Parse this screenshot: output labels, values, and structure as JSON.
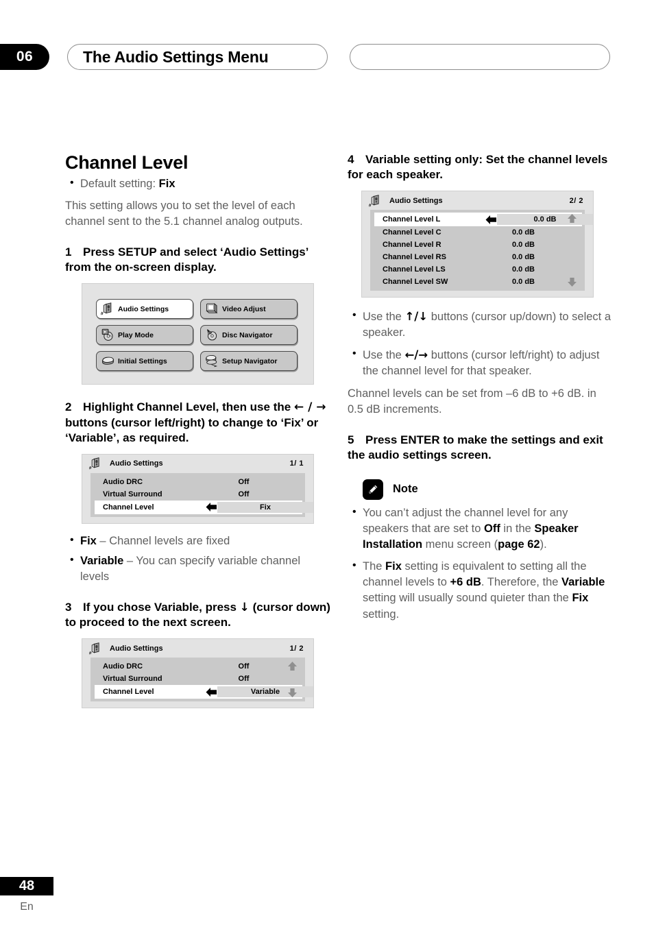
{
  "header": {
    "chapter_number": "06",
    "chapter_title": "The Audio Settings Menu"
  },
  "left_column": {
    "section_title": "Channel Level",
    "default_bullet_prefix": "Default setting: ",
    "default_bullet_value": "Fix",
    "intro_paragraph": "This setting allows you to set the level of each channel sent to the 5.1 channel analog outputs.",
    "step1": "1 Press SETUP and select ‘Audio Set-tings’ from the on-screen display.",
    "step1_num": "1",
    "step1_text": "Press SETUP and select ‘Audio Settings’ from the on-screen display.",
    "setup_menu": {
      "buttons": [
        {
          "label": "Audio Settings",
          "icon": "speaker-icon",
          "selected": true
        },
        {
          "label": "Video Adjust",
          "icon": "monitor-icon",
          "selected": false
        },
        {
          "label": "Play Mode",
          "icon": "play-disc-icon",
          "selected": false
        },
        {
          "label": "Disc Navigator",
          "icon": "disc-navigator-icon",
          "selected": false
        },
        {
          "label": "Initial Settings",
          "icon": "slab-icon",
          "selected": false
        },
        {
          "label": "Setup Navigator",
          "icon": "setup-navigator-icon",
          "selected": false
        }
      ]
    },
    "step2_num": "2",
    "step2_text_a": "Highlight Channel Level, then use the ",
    "step2_arrows": "← / →",
    "step2_text_b": " buttons (cursor left/right) to change to ‘Fix’ or ‘Variable’, as required.",
    "osd_fix": {
      "title": "Audio Settings",
      "page": "1/ 1",
      "rows": [
        {
          "name": "Audio DRC",
          "value": "Off",
          "selected": false
        },
        {
          "name": "Virtual Surround",
          "value": "Off",
          "selected": false
        },
        {
          "name": "Channel Level",
          "value": "Fix",
          "selected": true
        }
      ],
      "scroll_up": false,
      "scroll_down": false
    },
    "option_bullets": [
      {
        "term": "Fix",
        "desc": " – Channel levels are fixed"
      },
      {
        "term": "Variable",
        "desc": " – You can specify variable channel levels"
      }
    ],
    "step3_num": "3",
    "step3_text_a": "If you chose Variable, press ",
    "step3_arrow": "↓",
    "step3_text_b": " (cursor down) to proceed to the next screen.",
    "osd_variable": {
      "title": "Audio Settings",
      "page": "1/ 2",
      "rows": [
        {
          "name": "Audio DRC",
          "value": "Off",
          "selected": false
        },
        {
          "name": "Virtual Surround",
          "value": "Off",
          "selected": false
        },
        {
          "name": "Channel Level",
          "value": "Variable",
          "selected": true
        }
      ],
      "scroll_up": true,
      "scroll_down": true
    }
  },
  "right_column": {
    "step4_num": "4",
    "step4_text": "Variable setting only: Set the channel levels for each speaker.",
    "osd_levels": {
      "title": "Audio Settings",
      "page": "2/ 2",
      "rows": [
        {
          "name": "Channel Level L",
          "value": "0.0 dB",
          "selected": true
        },
        {
          "name": "Channel Level C",
          "value": "0.0 dB",
          "selected": false
        },
        {
          "name": "Channel Level R",
          "value": "0.0 dB",
          "selected": false
        },
        {
          "name": "Channel Level RS",
          "value": "0.0 dB",
          "selected": false
        },
        {
          "name": "Channel Level LS",
          "value": "0.0 dB",
          "selected": false
        },
        {
          "name": "Channel Level SW",
          "value": "0.0 dB",
          "selected": false
        }
      ],
      "scroll_up": true,
      "scroll_down": true
    },
    "usage_bullets": [
      {
        "pre": "Use the ",
        "arrows": "↑/↓",
        "post": " buttons (cursor up/down) to select a speaker."
      },
      {
        "pre": "Use the ",
        "arrows": "←/→",
        "post": " buttons (cursor left/right) to adjust the channel level for that speaker."
      }
    ],
    "range_paragraph": "Channel levels can be set from –6 dB to +6 dB. in 0.5 dB increments.",
    "step5_num": "5",
    "step5_text": "Press ENTER to make the settings and exit the audio settings screen.",
    "note_label": "Note",
    "note_bullets": [
      {
        "parts": [
          {
            "t": "You can’t adjust the channel level for any speakers that are set to ",
            "b": false
          },
          {
            "t": "Off",
            "b": true
          },
          {
            "t": " in the ",
            "b": false
          },
          {
            "t": "Speaker Installation",
            "b": true
          },
          {
            "t": " menu screen (",
            "b": false
          },
          {
            "t": "page 62",
            "b": true
          },
          {
            "t": ").",
            "b": false
          }
        ]
      },
      {
        "parts": [
          {
            "t": "The ",
            "b": false
          },
          {
            "t": "Fix",
            "b": true
          },
          {
            "t": " setting is equivalent to setting all the channel levels to ",
            "b": false
          },
          {
            "t": "+6 dB",
            "b": true
          },
          {
            "t": ". Therefore, the ",
            "b": false
          },
          {
            "t": "Variable",
            "b": true
          },
          {
            "t": " setting will usually sound quieter than the ",
            "b": false
          },
          {
            "t": "Fix",
            "b": true
          },
          {
            "t": " setting.",
            "b": false
          }
        ]
      }
    ]
  },
  "footer": {
    "page_number": "48",
    "language": "En"
  },
  "colors": {
    "ink": "#000000",
    "body_gray": "#5f5f5f",
    "osd_header_bg": "#e3e3e3",
    "osd_body_bg": "#c9c9c9",
    "osd_selected_bg": "#ffffff",
    "osd_field_bg": "#d9d9d9",
    "button_bg": "#c8c8c8"
  }
}
